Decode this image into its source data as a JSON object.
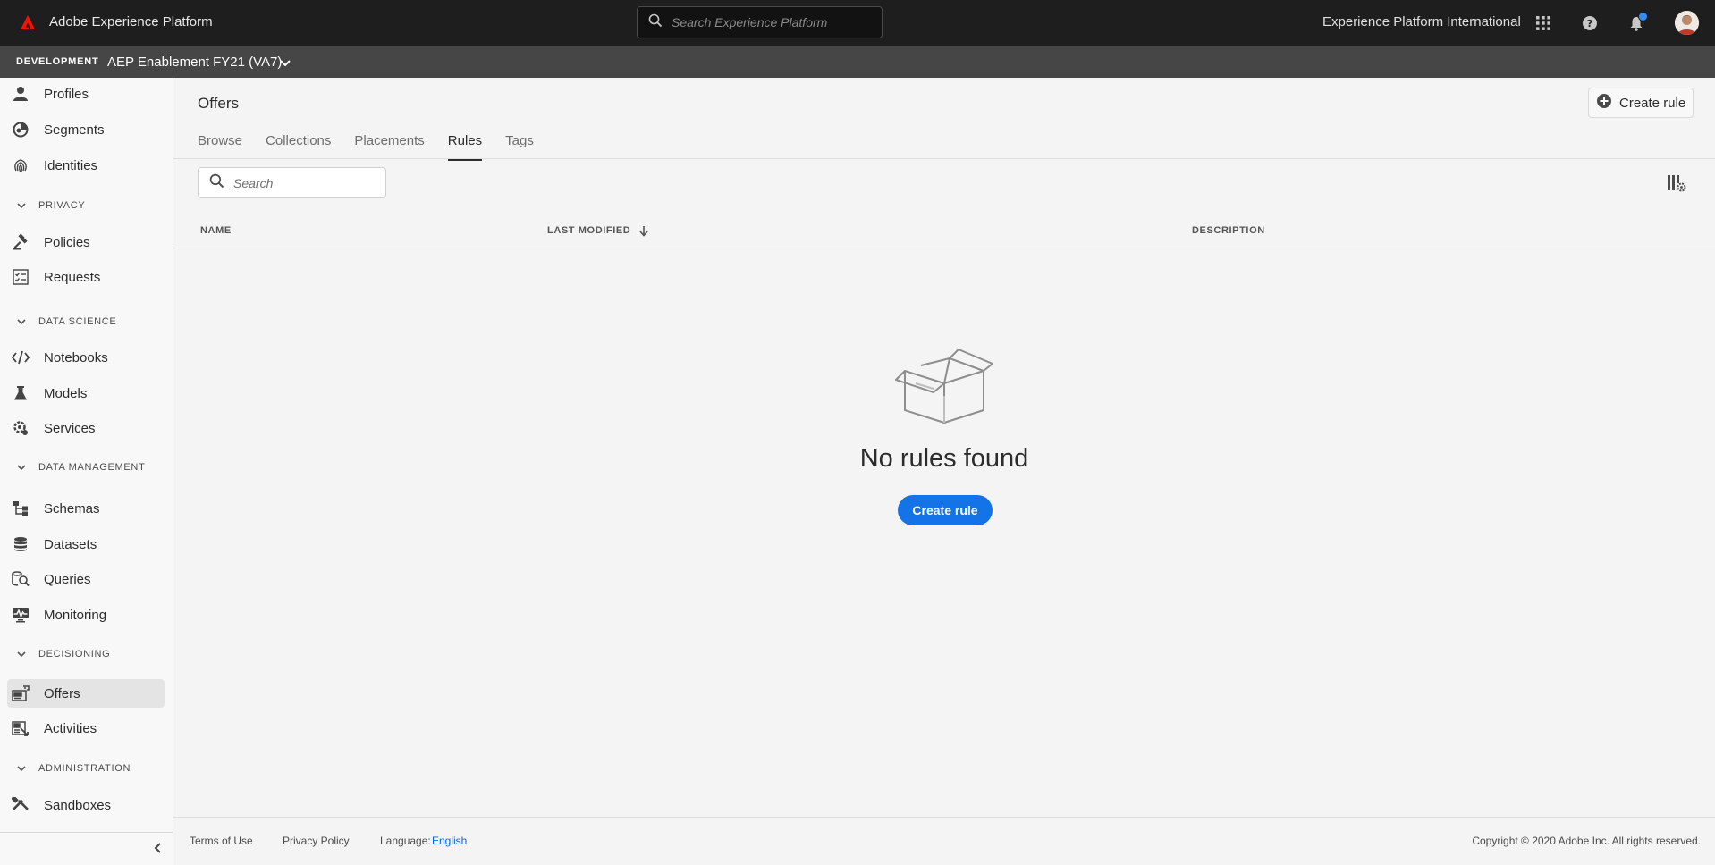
{
  "topbar": {
    "app_title": "Adobe Experience Platform",
    "search_placeholder": "Search Experience Platform",
    "org_name": "Experience Platform International",
    "icons": [
      "adobe-logo-icon",
      "search-icon",
      "apps-grid-icon",
      "help-icon",
      "bell-icon",
      "avatar"
    ]
  },
  "sandbox": {
    "environment": "DEVELOPMENT",
    "name": "AEP Enablement FY21 (VA7)"
  },
  "sidebar": {
    "items": [
      {
        "label": "Profiles",
        "icon": "profile-icon"
      },
      {
        "label": "Segments",
        "icon": "segments-icon"
      },
      {
        "label": "Identities",
        "icon": "fingerprint-icon"
      },
      {
        "label": "Policies",
        "icon": "gavel-icon"
      },
      {
        "label": "Requests",
        "icon": "checklist-icon"
      },
      {
        "label": "Notebooks",
        "icon": "code-icon"
      },
      {
        "label": "Models",
        "icon": "flask-icon"
      },
      {
        "label": "Services",
        "icon": "gear-services-icon"
      },
      {
        "label": "Schemas",
        "icon": "schema-icon"
      },
      {
        "label": "Datasets",
        "icon": "database-icon"
      },
      {
        "label": "Queries",
        "icon": "query-icon"
      },
      {
        "label": "Monitoring",
        "icon": "monitor-icon"
      },
      {
        "label": "Offers",
        "icon": "offers-icon",
        "active": true
      },
      {
        "label": "Activities",
        "icon": "activities-icon"
      },
      {
        "label": "Sandboxes",
        "icon": "tools-icon"
      }
    ],
    "sections": [
      "PRIVACY",
      "DATA SCIENCE",
      "DATA MANAGEMENT",
      "DECISIONING",
      "ADMINISTRATION"
    ]
  },
  "main": {
    "title": "Offers",
    "create_rule_label": "Create rule",
    "tabs": [
      {
        "label": "Browse"
      },
      {
        "label": "Collections"
      },
      {
        "label": "Placements"
      },
      {
        "label": "Rules",
        "active": true
      },
      {
        "label": "Tags"
      }
    ],
    "search_placeholder": "Search",
    "columns": {
      "name": "NAME",
      "last_modified": "LAST MODIFIED",
      "description": "DESCRIPTION"
    },
    "empty_state": {
      "message": "No rules found",
      "cta_label": "Create rule"
    }
  },
  "footer": {
    "terms": "Terms of Use",
    "privacy": "Privacy Policy",
    "language_label": "Language:",
    "language_value": "English",
    "copyright": "Copyright ©  2020 Adobe Inc.  All rights reserved."
  },
  "colors": {
    "topbar_bg": "#1e1e1e",
    "sandbox_bg": "#464646",
    "accent": "#1473e6",
    "adobe_red": "#fa0f00",
    "notification": "#2f8ef5",
    "link": "#0d66d0"
  }
}
